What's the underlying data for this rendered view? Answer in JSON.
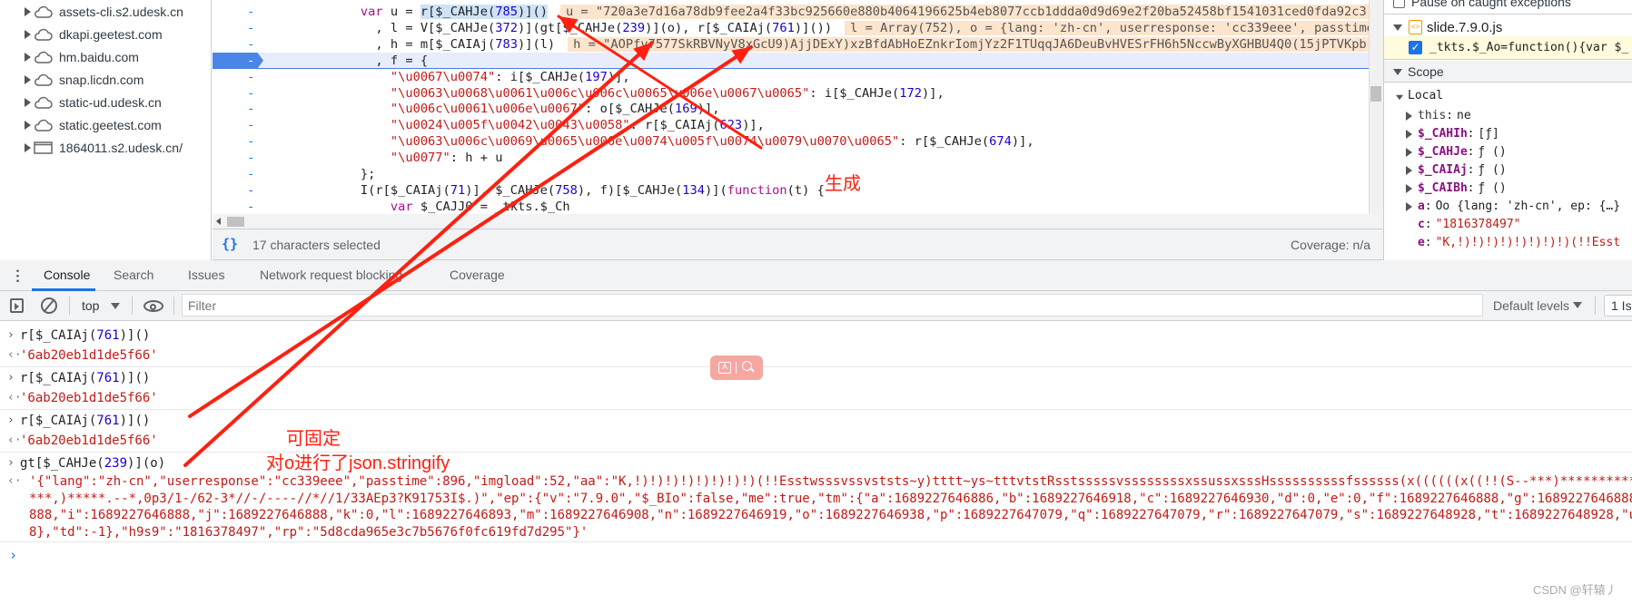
{
  "colors": {
    "annotation": "#ff2010",
    "accent": "#1a73e8",
    "keyword": "#aa0d91",
    "string": "#c41a16",
    "number": "#1c00cf",
    "preview_bg": "#fde4cd"
  },
  "sidebar": {
    "items": [
      {
        "label": "assets-cli.s2.udesk.cn",
        "icon": "cloud-icon"
      },
      {
        "label": "dkapi.geetest.com",
        "icon": "cloud-icon"
      },
      {
        "label": "hm.baidu.com",
        "icon": "cloud-icon"
      },
      {
        "label": "snap.licdn.com",
        "icon": "cloud-icon"
      },
      {
        "label": "static-ud.udesk.cn",
        "icon": "cloud-icon"
      },
      {
        "label": "static.geetest.com",
        "icon": "cloud-icon"
      },
      {
        "label": "1864011.s2.udesk.cn/",
        "icon": "frame-icon"
      }
    ]
  },
  "editor": {
    "line_marker": "-",
    "lines": [
      {
        "indent": 12,
        "text": "var u = r[$_CAHJe(785)]()",
        "selected": "r[$_CAHJe(785)]()",
        "preview": "u = \"720a3e7d16a78db9fee2a4f33bc925660e880b4064196625b4eb8077ccb1ddda0d9d69e2f20ba52458bf1541031ced0fda92c3"
      },
      {
        "indent": 14,
        "text": ", l = V[$_CAHJe(372)](gt[$_CAHJe(239)](o), r[$_CAIAj(761)]())",
        "preview": "l = Array(752), o = {lang: 'zh-cn', userresponse: 'cc339eee', passtime"
      },
      {
        "indent": 14,
        "text": ", h = m[$_CAIAj(783)](l)",
        "preview": "h = \"AOPfv7577SkRBVNyV8xGcU9)AjjDExY)xzBfdAbHoEZnkrIomjYz2F1TUqqJA6DeuBvHVESrFH6h5NccwByXGHBU4Q0(15jPTVKpb"
      },
      {
        "indent": 14,
        "text": ", f = {",
        "active": true
      },
      {
        "indent": 16,
        "text": "\"\\u0067\\u0074\": i[$_CAHJe(197)],"
      },
      {
        "indent": 16,
        "text": "\"\\u0063\\u0068\\u0061\\u006c\\u006c\\u0065\\u006e\\u0067\\u0065\": i[$_CAHJe(172)],"
      },
      {
        "indent": 16,
        "text": "\"\\u006c\\u0061\\u006e\\u0067\": o[$_CAHJe(169)],"
      },
      {
        "indent": 16,
        "text": "\"\\u0024\\u005f\\u0042\\u0043\\u0058\": r[$_CAIAj(623)],"
      },
      {
        "indent": 16,
        "text": "\"\\u0063\\u006c\\u0069\\u0065\\u006e\\u0074\\u005f\\u0074\\u0079\\u0070\\u0065\": r[$_CAHJe(674)],"
      },
      {
        "indent": 16,
        "text": "\"\\u0077\": h + u"
      },
      {
        "indent": 12,
        "text": "};"
      },
      {
        "indent": 12,
        "text": "I(r[$_CAIAj(71)], $_CAHJe(758), f)[$_CAHJe(134)](function(t) {"
      },
      {
        "indent": 16,
        "text": "var $_CAJJ0 = _tkts.$_Ch"
      }
    ],
    "status_text": "17 characters selected",
    "coverage": "Coverage: n/a"
  },
  "right_panel": {
    "pause_label": "Pause on caught exceptions",
    "file": "slide.7.9.0.js",
    "breakpoint": "_tkts.$_Ao=function(){var $_",
    "scope_title": "Scope",
    "local_title": "Local",
    "vars": [
      {
        "key": "this",
        "value": "ne",
        "expandable": true,
        "plain": true
      },
      {
        "key": "$_CAHIh",
        "value": "[ƒ]",
        "expandable": true
      },
      {
        "key": "$_CAHJe",
        "value": "ƒ ()",
        "expandable": true
      },
      {
        "key": "$_CAIAj",
        "value": "ƒ ()",
        "expandable": true
      },
      {
        "key": "$_CAIBh",
        "value": "ƒ ()",
        "expandable": true
      },
      {
        "key": "a",
        "value": "Oo {lang: 'zh-cn', ep: {…}",
        "expandable": true
      },
      {
        "key": "c",
        "value": "\"1816378497\"",
        "string": true
      },
      {
        "key": "e",
        "value": "\"K,!)!)!)!)!)!)!)!)(!!Esst",
        "string": true
      }
    ]
  },
  "drawer": {
    "tabs": [
      "Console",
      "Search",
      "Issues",
      "Network request blocking",
      "Coverage"
    ],
    "active_tab": "Console"
  },
  "console_toolbar": {
    "context": "top",
    "filter_placeholder": "Filter",
    "levels": "Default levels",
    "issues": "1 Is"
  },
  "console": {
    "entries": [
      {
        "input": "r[$_CAIAj(761)]()",
        "output": [
          "'6ab20eb1d1de5f66'"
        ]
      },
      {
        "input": "r[$_CAIAj(761)]()",
        "output": [
          "'6ab20eb1d1de5f66'"
        ]
      },
      {
        "input": "r[$_CAIAj(761)]()",
        "output": [
          "'6ab20eb1d1de5f66'"
        ]
      },
      {
        "input": "gt[$_CAHJe(239)](o)",
        "output": [
          "'{\"lang\":\"zh-cn\",\"userresponse\":\"cc339eee\",\"passtime\":896,\"imgload\":52,\"aa\":\"K,!)!)!)!)!)!)!)!)(!!Esstwsssvssvststs~y)tttt~ys~tttvtstRsstsssssvssssssssxssussxsssHssssssssssfssssss(x((((((x((!!(S--***)***********,),",
          "***,)*****.--*,0p3/1-/62-3*//-/----//*//1/33AEp3?K91753I$.)\",\"ep\":{\"v\":\"7.9.0\",\"$_BIo\":false,\"me\":true,\"tm\":{\"a\":1689227646886,\"b\":1689227646918,\"c\":1689227646930,\"d\":0,\"e\":0,\"f\":1689227646888,\"g\":1689227646888,\"h\"",
          "888,\"i\":1689227646888,\"j\":1689227646888,\"k\":0,\"l\":1689227646893,\"m\":1689227646908,\"n\":1689227646919,\"o\":1689227646938,\"p\":1689227647079,\"q\":1689227647079,\"r\":1689227647079,\"s\":1689227648928,\"t\":1689227648928,\"u\":168",
          "8},\"td\":-1},\"h9s9\":\"1816378497\",\"rp\":\"5d8cda965e3c7b5676f0fc619fd7d295\"}'"
        ]
      }
    ]
  },
  "annotations": {
    "generated": "生成",
    "fixed": "可固定",
    "stringify_note": "对o进行了json.stringify"
  },
  "watermark": "CSDN @轩辕丿"
}
